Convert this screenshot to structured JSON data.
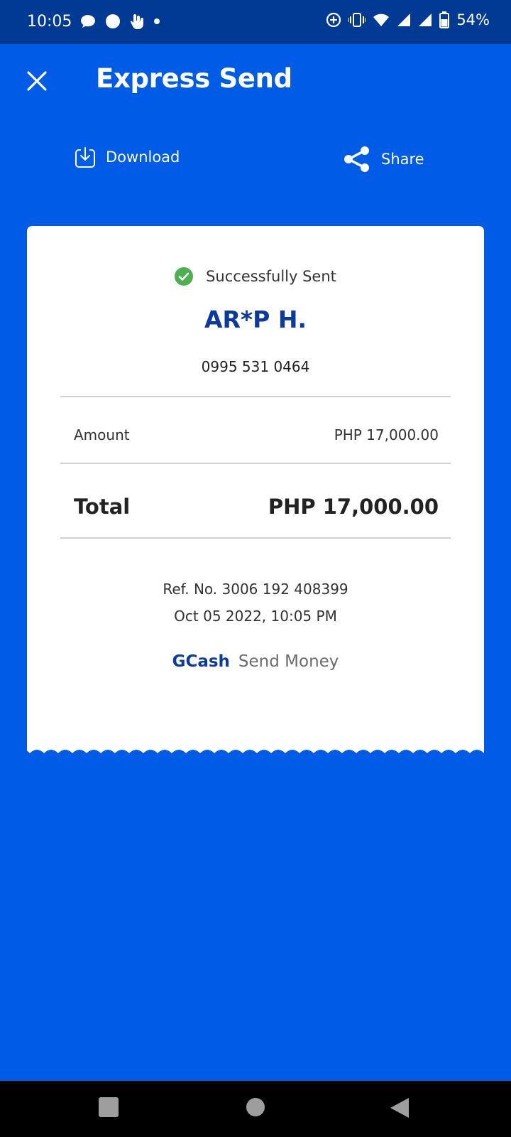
{
  "status_bar": {
    "time": "10:05",
    "battery": "54%",
    "left_icons": [
      "message-icon",
      "circle-icon",
      "touch-icon",
      "dot-icon"
    ],
    "right_icons": [
      "sync-icon",
      "vibrate-icon",
      "wifi-icon",
      "signal-icon",
      "signal-icon",
      "battery-icon"
    ]
  },
  "header": {
    "title": "Express Send"
  },
  "actions": {
    "download_label": "Download",
    "share_label": "Share"
  },
  "receipt": {
    "status_text": "Successfully Sent",
    "recipient_name": "AR*P H.",
    "recipient_phone": "0995 531 0464",
    "amount_label": "Amount",
    "amount_value": "PHP 17,000.00",
    "total_label": "Total",
    "total_value": "PHP 17,000.00",
    "reference": "Ref. No. 3006 192 408399",
    "datetime": "Oct 05 2022, 10:05 PM",
    "brand_name": "GCash",
    "brand_service": "Send Money"
  },
  "colors": {
    "background": "#005ce6",
    "status_bar": "#003a94",
    "accent_text": "#0b3a9e",
    "success": "#4caf50"
  },
  "nav": {
    "buttons": [
      "recents-button",
      "home-button",
      "back-button"
    ]
  }
}
